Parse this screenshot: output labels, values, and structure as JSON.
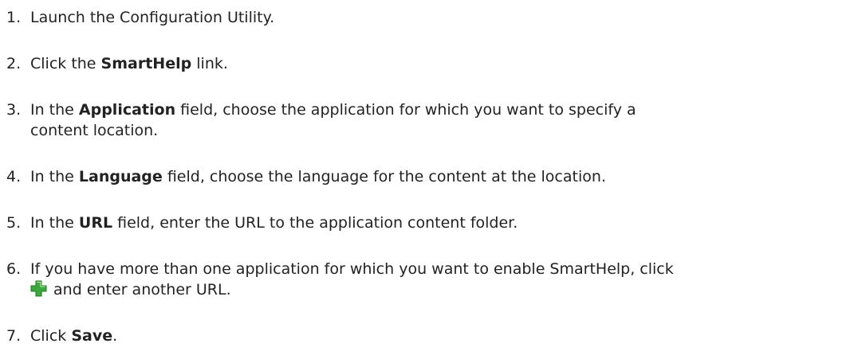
{
  "steps": [
    {
      "number": "1.",
      "text": "Launch the Configuration Utility."
    },
    {
      "number": "2.",
      "pre": "Click the ",
      "bold": "SmartHelp",
      "post": " link."
    },
    {
      "number": "3.",
      "pre": "In the ",
      "bold": "Application",
      "post": " field, choose the application for which you want to specify a",
      "line2": "content location."
    },
    {
      "number": "4.",
      "pre": "In the ",
      "bold": "Language",
      "post": " field, choose the language for the content at the location."
    },
    {
      "number": "5.",
      "pre": "In the ",
      "bold": "URL",
      "post": " field, enter the URL to the application content folder."
    },
    {
      "number": "6.",
      "text": "If you have more than one application for which you want to enable SmartHelp, click",
      "line2": " and enter another URL.",
      "icon": "add-icon",
      "icon_color": "#3aa83a"
    },
    {
      "number": "7.",
      "pre": "Click ",
      "bold": "Save",
      "post": "."
    }
  ]
}
